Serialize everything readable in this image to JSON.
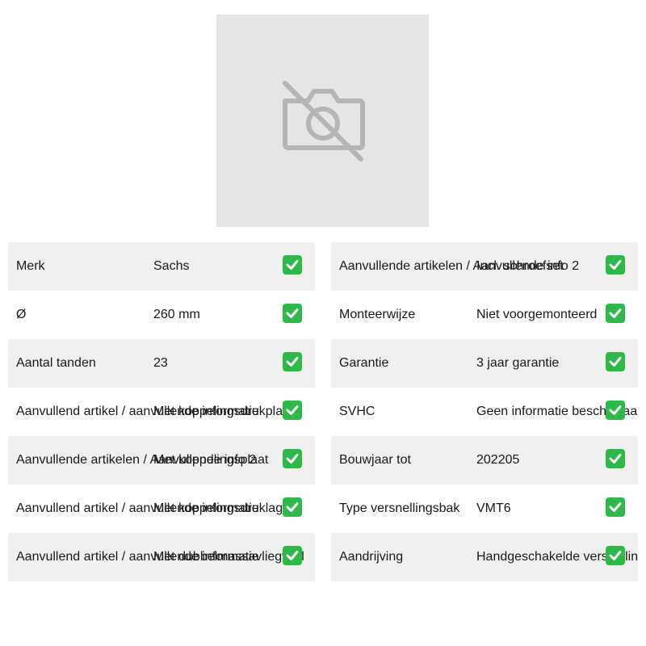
{
  "image": {
    "icon": "no-photo-icon"
  },
  "left_table": [
    {
      "label": "Merk",
      "value": "Sachs"
    },
    {
      "label": "Ø",
      "value": "260 mm"
    },
    {
      "label": "Aantal tanden",
      "value": "23"
    },
    {
      "label": "Aanvullend artikel / aanvullende informatie",
      "value": "Met koppelingsdrukplaat"
    },
    {
      "label": "Aanvullende artikelen / Aanvullende info 2",
      "value": "Met koppelingsplaat"
    },
    {
      "label": "Aanvullend artikel / aanvullende informatie",
      "value": "Met koppelingsdruklager"
    },
    {
      "label": "Aanvullend artikel / aanvullende informatie",
      "value": "Met dubbelmassavliegwiel"
    }
  ],
  "right_table": [
    {
      "label": "Aanvullende artikelen / Aanvullende info 2",
      "value": "Incl. schroefset"
    },
    {
      "label": "Monteerwijze",
      "value": "Niet voorgemonteerd"
    },
    {
      "label": "Garantie",
      "value": "3 jaar garantie"
    },
    {
      "label": "SVHC",
      "value": "Geen informatie beschikbaar"
    },
    {
      "label": "Bouwjaar tot",
      "value": "202205"
    },
    {
      "label": "Type versnellingsbak",
      "value": "VMT6"
    },
    {
      "label": "Aandrijving",
      "value": "Handgeschakelde versnellingsbak"
    }
  ],
  "status_icon": "check-mark-icon",
  "colors": {
    "row_alt": "#f0f0f0",
    "check_green": "#2eb84a",
    "placeholder_bg": "#e5e5e5"
  }
}
